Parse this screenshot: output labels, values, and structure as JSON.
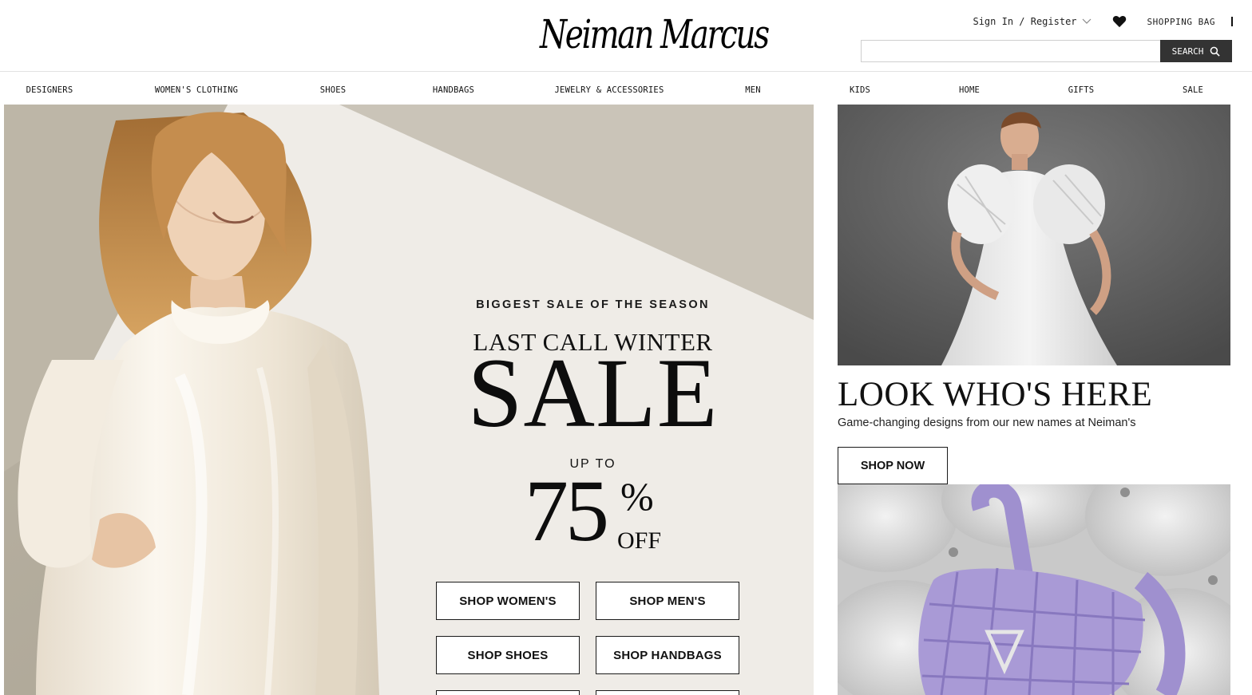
{
  "header": {
    "logo_text": "Neiman Marcus",
    "sign_in_label": "Sign In / Register",
    "shopping_bag_label": "SHOPPING BAG",
    "search": {
      "placeholder": "",
      "button_label": "SEARCH"
    }
  },
  "nav": {
    "items": [
      {
        "label": "DESIGNERS"
      },
      {
        "label": "WOMEN'S CLOTHING"
      },
      {
        "label": "SHOES"
      },
      {
        "label": "HANDBAGS"
      },
      {
        "label": "JEWELRY & ACCESSORIES"
      },
      {
        "label": "MEN"
      },
      {
        "label": "KIDS"
      },
      {
        "label": "HOME"
      },
      {
        "label": "GIFTS"
      },
      {
        "label": "SALE"
      }
    ]
  },
  "hero": {
    "eyebrow": "BIGGEST SALE OF THE SEASON",
    "headline_small": "LAST CALL WINTER",
    "headline_big": "SALE",
    "up_to": "UP TO",
    "percent": "75",
    "percent_sign": "%",
    "off": "OFF",
    "buttons": [
      {
        "label": "SHOP WOMEN'S"
      },
      {
        "label": "SHOP MEN'S"
      },
      {
        "label": "SHOP SHOES"
      },
      {
        "label": "SHOP HANDBAGS"
      }
    ]
  },
  "feature": {
    "title": "LOOK WHO'S HERE",
    "subtitle": "Game-changing designs from our new names at Neiman's",
    "button_label": "SHOP NOW"
  },
  "icons": {
    "heart": "heart-icon",
    "search": "search-icon",
    "chevron": "chevron-down-icon"
  },
  "colors": {
    "search_button_bg": "#333333",
    "bag_purple": "#a99ad6"
  }
}
